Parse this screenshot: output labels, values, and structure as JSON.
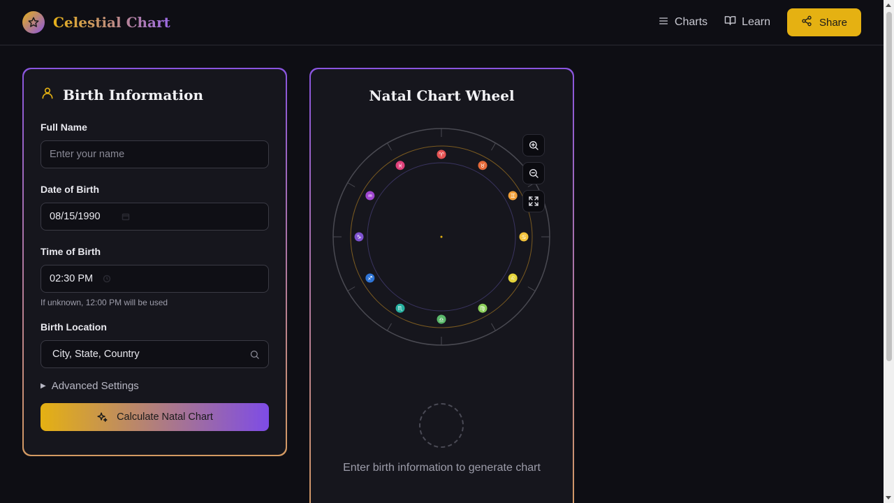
{
  "app": {
    "title": "Celestial Chart"
  },
  "nav": {
    "charts": "Charts",
    "learn": "Learn",
    "share": "Share"
  },
  "form": {
    "title": "Birth Information",
    "name_label": "Full Name",
    "name_placeholder": "Enter your name",
    "dob_label": "Date of Birth",
    "dob_value": "08/15/1990",
    "tob_label": "Time of Birth",
    "tob_value": "02:30 PM",
    "tob_hint": "If unknown, 12:00 PM will be used",
    "location_label": "Birth Location",
    "location_value": "City, State, Country",
    "advanced": "Advanced Settings",
    "calculate": "Calculate Natal Chart"
  },
  "chart": {
    "title": "Natal Chart Wheel",
    "empty_text": "Enter birth information to generate chart",
    "zodiac": [
      {
        "symbol": "♈",
        "color": "#e55454"
      },
      {
        "symbol": "♉",
        "color": "#e56a3a"
      },
      {
        "symbol": "♊",
        "color": "#f2a03a"
      },
      {
        "symbol": "♋",
        "color": "#f2c23a"
      },
      {
        "symbol": "♌",
        "color": "#e5d43a"
      },
      {
        "symbol": "♍",
        "color": "#8ccf5a"
      },
      {
        "symbol": "♎",
        "color": "#5ab86a"
      },
      {
        "symbol": "♏",
        "color": "#26b0a0"
      },
      {
        "symbol": "♐",
        "color": "#2e74d6"
      },
      {
        "symbol": "♑",
        "color": "#7e52d0"
      },
      {
        "symbol": "♒",
        "color": "#a046d0"
      },
      {
        "symbol": "♓",
        "color": "#e0407a"
      }
    ]
  },
  "colors": {
    "accent": "#e5b112",
    "purple": "#8a55e0"
  }
}
